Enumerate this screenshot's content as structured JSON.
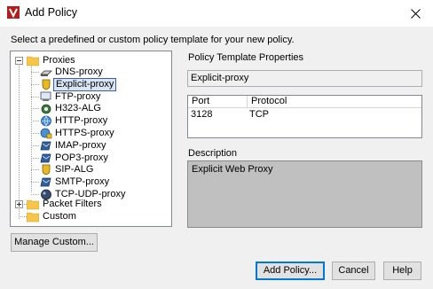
{
  "window": {
    "title": "Add Policy"
  },
  "instruction": "Select a predefined or custom policy template for your new policy.",
  "tree": {
    "root_label": "Proxies",
    "proxies": [
      {
        "label": "DNS-proxy",
        "icon": "dns-icon"
      },
      {
        "label": "Explicit-proxy",
        "icon": "shield-icon",
        "selected": true
      },
      {
        "label": "FTP-proxy",
        "icon": "ftp-icon"
      },
      {
        "label": "H323-ALG",
        "icon": "h323-icon"
      },
      {
        "label": "HTTP-proxy",
        "icon": "globe-icon"
      },
      {
        "label": "HTTPS-proxy",
        "icon": "globe-lock-icon"
      },
      {
        "label": "IMAP-proxy",
        "icon": "mail-icon"
      },
      {
        "label": "POP3-proxy",
        "icon": "mail-icon"
      },
      {
        "label": "SIP-ALG",
        "icon": "shield-icon"
      },
      {
        "label": "SMTP-proxy",
        "icon": "mail-icon"
      },
      {
        "label": "TCP-UDP-proxy",
        "icon": "network-icon"
      }
    ],
    "packet_filters_label": "Packet Filters",
    "custom_label": "Custom"
  },
  "properties": {
    "heading": "Policy Template Properties",
    "name": "Explicit-proxy",
    "columns": [
      "Port",
      "Protocol"
    ],
    "rows": [
      {
        "port": "3128",
        "protocol": "TCP"
      }
    ],
    "description_label": "Description",
    "description": "Explicit Web Proxy"
  },
  "buttons": {
    "manage_custom": "Manage Custom...",
    "add_policy": "Add Policy...",
    "cancel": "Cancel",
    "help": "Help"
  },
  "colors": {
    "selection_border": "#3c5ea8",
    "folder": "#f5c64a",
    "default_button_border": "#0078d7"
  }
}
